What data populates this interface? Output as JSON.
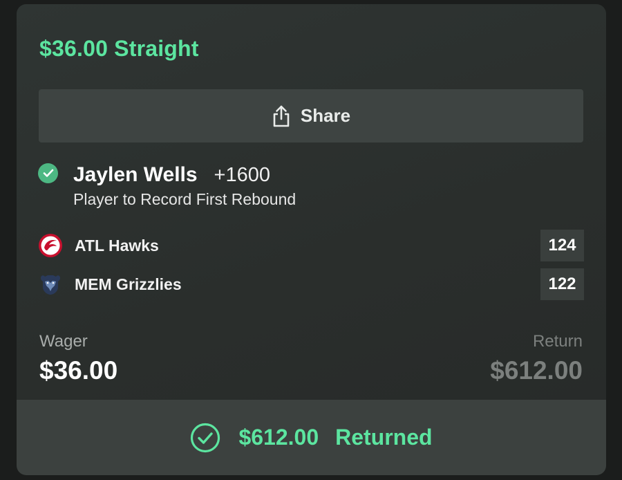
{
  "bet": {
    "title": "$36.00 Straight",
    "share_label": "Share",
    "selection": {
      "player": "Jaylen Wells",
      "odds": "+1600",
      "market": "Player to Record First Rebound",
      "status": "won"
    },
    "teams": [
      {
        "name": "ATL Hawks",
        "score": "124",
        "logo_icon": "atlanta-hawks-logo-icon"
      },
      {
        "name": "MEM Grizzlies",
        "score": "122",
        "logo_icon": "memphis-grizzlies-logo-icon"
      }
    ],
    "wager_label": "Wager",
    "wager_value": "$36.00",
    "return_label": "Return",
    "return_value": "$612.00",
    "result_amount": "$612.00",
    "result_status": "Returned"
  },
  "colors": {
    "accent": "#5ce5a0",
    "check_badge": "#4db883",
    "card_bg": "#2d3231",
    "button_bg": "#3e4442",
    "hawks_red": "#c8102e",
    "grizzlies_navy": "#2a3a5a"
  }
}
